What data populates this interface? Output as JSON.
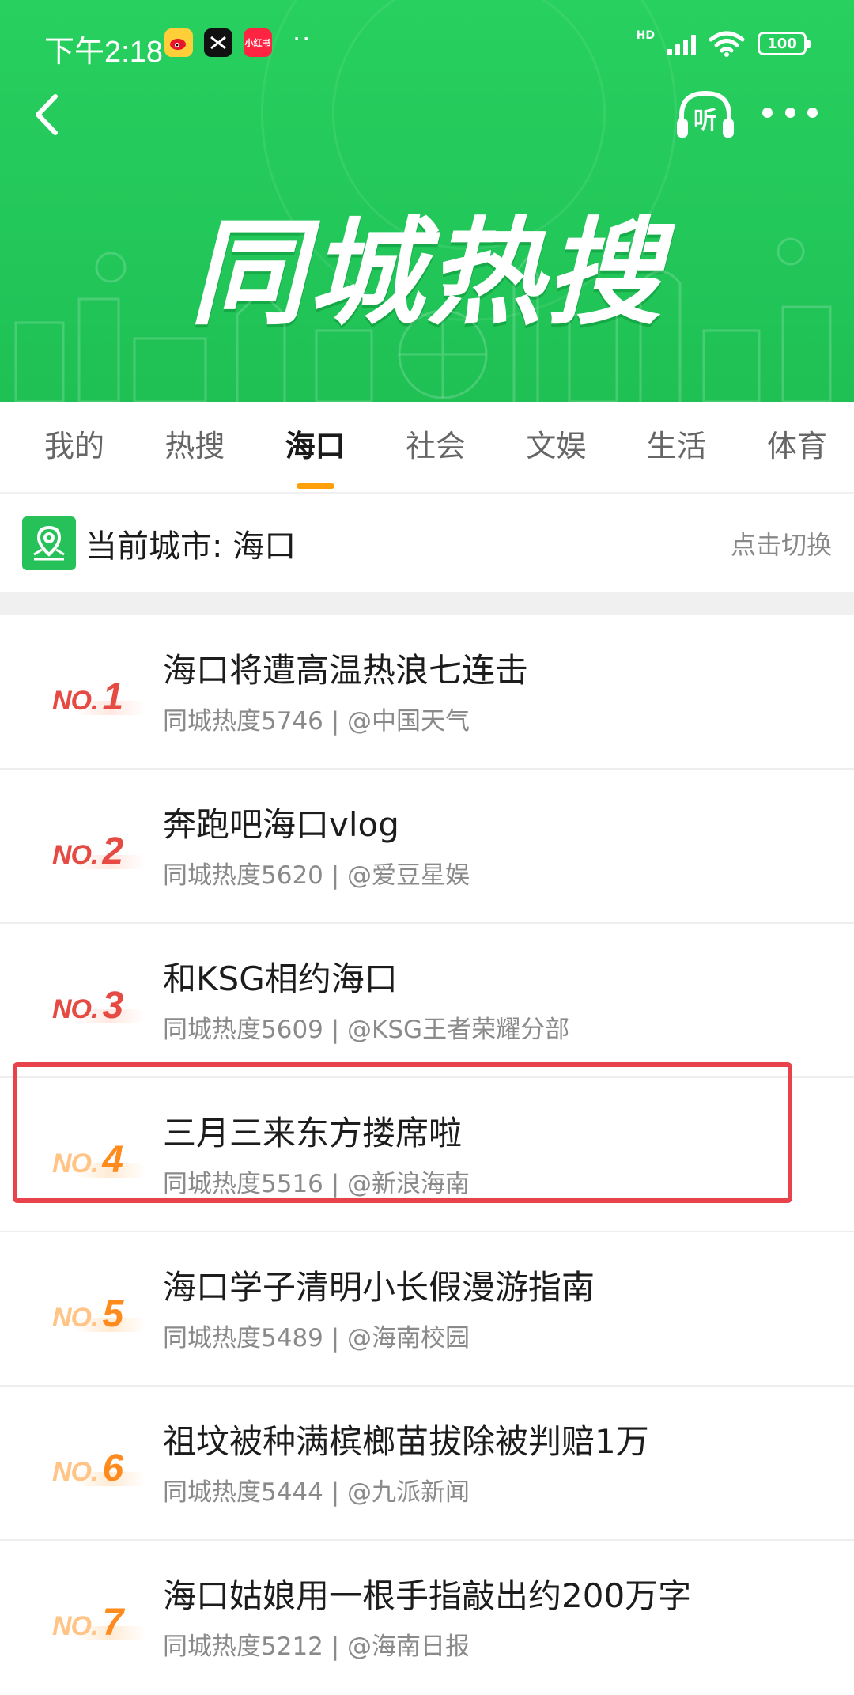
{
  "status_bar": {
    "time": "下午2:18",
    "hd": "HD",
    "battery": "100",
    "dots": "··",
    "app_icons": [
      "weibo-icon",
      "capcut-icon",
      "xiaohongshu-icon"
    ],
    "xiaohongshu_label": "小红书"
  },
  "header": {
    "banner_title": "同城热搜",
    "listen_label": "听"
  },
  "tabs": [
    {
      "label": "我的"
    },
    {
      "label": "热搜"
    },
    {
      "label": "海口",
      "active": true
    },
    {
      "label": "社会"
    },
    {
      "label": "文娱"
    },
    {
      "label": "生活"
    },
    {
      "label": "体育"
    }
  ],
  "city": {
    "label": "当前城市: 海口",
    "switch_label": "点击切换"
  },
  "list": [
    {
      "rank_prefix": "NO.",
      "rank": "1",
      "title": "海口将遭高温热浪七连击",
      "meta": "同城热度5746 | @中国天气"
    },
    {
      "rank_prefix": "NO.",
      "rank": "2",
      "title": "奔跑吧海口vlog",
      "meta": "同城热度5620 | @爱豆星娱"
    },
    {
      "rank_prefix": "NO.",
      "rank": "3",
      "title": "和KSG相约海口",
      "meta": "同城热度5609 | @KSG王者荣耀分部"
    },
    {
      "rank_prefix": "NO.",
      "rank": "4",
      "title": "三月三来东方搂席啦",
      "meta": "同城热度5516 | @新浪海南"
    },
    {
      "rank_prefix": "NO.",
      "rank": "5",
      "title": "海口学子清明小长假漫游指南",
      "meta": "同城热度5489 | @海南校园"
    },
    {
      "rank_prefix": "NO.",
      "rank": "6",
      "title": "祖坟被种满槟榔苗拔除被判赔1万",
      "meta": "同城热度5444 | @九派新闻"
    },
    {
      "rank_prefix": "NO.",
      "rank": "7",
      "title": "海口姑娘用一根手指敲出约200万字",
      "meta": "同城热度5212 | @海南日报"
    }
  ],
  "colors": {
    "banner_green": "#23c85a",
    "tab_indicator": "#ff9f0a",
    "rank_red": "#e54b43",
    "rank_orange": "#ff8a1e",
    "highlight_border": "#e8434a"
  }
}
